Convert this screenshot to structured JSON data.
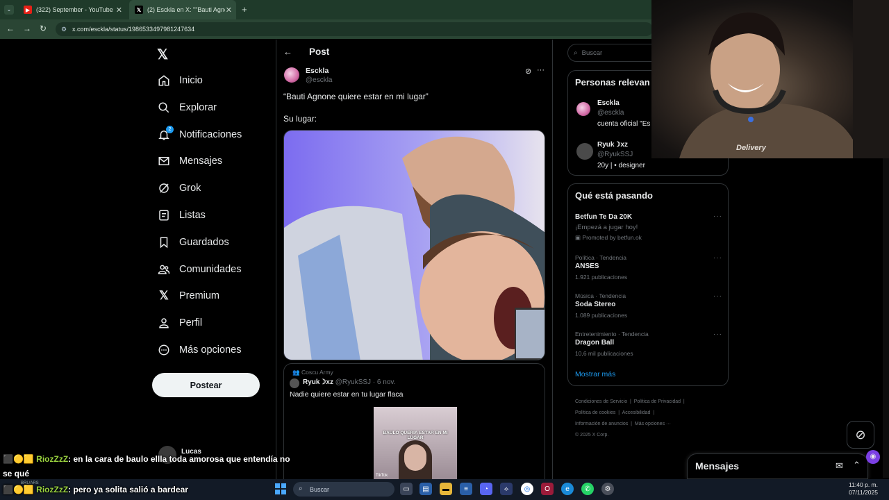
{
  "browser": {
    "tabs": [
      {
        "label": "(322) September - YouTube",
        "icon": "youtube-icon"
      },
      {
        "label": "(2) Esckla en X: \"\"Bauti Agnone",
        "icon": "x-logo-icon"
      }
    ],
    "new_tab": "+",
    "url": "x.com/esckla/status/1986533497981247634"
  },
  "sidebar": {
    "items": [
      {
        "label": "Inicio",
        "icon": "home-icon"
      },
      {
        "label": "Explorar",
        "icon": "search-icon"
      },
      {
        "label": "Notificaciones",
        "icon": "bell-icon",
        "badge": "2"
      },
      {
        "label": "Mensajes",
        "icon": "mail-icon"
      },
      {
        "label": "Grok",
        "icon": "grok-icon"
      },
      {
        "label": "Listas",
        "icon": "list-icon"
      },
      {
        "label": "Guardados",
        "icon": "bookmark-icon"
      },
      {
        "label": "Comunidades",
        "icon": "people-icon"
      },
      {
        "label": "Premium",
        "icon": "x-logo-icon"
      },
      {
        "label": "Perfil",
        "icon": "person-icon"
      },
      {
        "label": "Más opciones",
        "icon": "more-circle-icon"
      }
    ],
    "post_button": "Postear",
    "account_name": "Lucas"
  },
  "post": {
    "header": "Post",
    "author_name": "Esckla",
    "author_handle": "@esckla",
    "text_line1": "“Bauti Agnone quiere estar en mi lugar”",
    "text_line2": "Su lugar:",
    "quote": {
      "community": "Coscu Army",
      "author": "Ryuk☽xz",
      "handle": "@RyukSSJ",
      "date": "· 6 nov.",
      "text": "Nadie quiere estar en tu lugar flaca",
      "thumb_caption": "BAULO QUERIA ESTAR EN MI LUGAR",
      "thumb_brand": "TikTok"
    }
  },
  "right": {
    "search_placeholder": "Buscar",
    "relevant": {
      "title": "Personas relevan",
      "people": [
        {
          "name": "Esckla",
          "handle": "@esckla",
          "bio": "cuenta oficial \"Es"
        },
        {
          "name": "Ryuk☽xz",
          "handle": "@RyukSSJ",
          "bio": "20y | • designer"
        }
      ]
    },
    "trending": {
      "title": "Qué está pasando",
      "promo": {
        "name": "Betfun Te Da 20K",
        "sub": "¡Empezá a jugar hoy!",
        "promoted": "Promoted by betfun.ok"
      },
      "items": [
        {
          "context": "Política · Tendencia",
          "name": "ANSES",
          "count": "1.921 publicaciones"
        },
        {
          "context": "Música · Tendencia",
          "name": "Soda Stereo",
          "count": "1.089 publicaciones"
        },
        {
          "context": "Entretenimiento · Tendencia",
          "name": "Dragon Ball",
          "count": "10,6 mil publicaciones"
        }
      ],
      "show_more": "Mostrar más"
    },
    "footer": {
      "line1": [
        "Condiciones de Servicio",
        "Política de Privacidad"
      ],
      "line2": [
        "Política de cookies",
        "Accesibilidad"
      ],
      "line3": [
        "Información de anuncios",
        "Más opciones ···"
      ],
      "copyright": "© 2025 X Corp."
    },
    "messages_dock": "Mensajes"
  },
  "chat": {
    "line1_user": "RiozZzZ",
    "line1_text": ": en la cara de baulo ellla toda amorosa que entendía no",
    "line1_cont": "se qué",
    "line2_user": "RiozZzZ",
    "line2_text": ": pero ya solita salió a bardear",
    "ticker": "BRL/ARS"
  },
  "taskbar": {
    "search_placeholder": "Buscar",
    "time": "11:40 p. m.",
    "date": "07/11/2025"
  },
  "webcam": {
    "shirt_text": "Delivery"
  },
  "colors": {
    "accent": "#1d9bf0",
    "bg": "#000000",
    "border": "#2f3336",
    "muted": "#71767b"
  }
}
